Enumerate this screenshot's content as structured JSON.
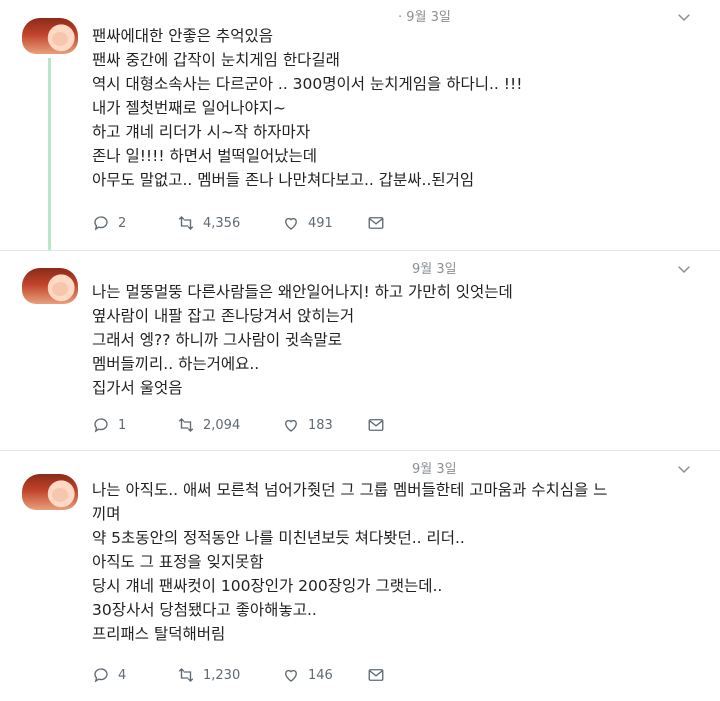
{
  "tweets": [
    {
      "date": "· 9월 3일",
      "lines": [
        "팬싸에대한 안좋은 추억있음",
        "팬싸 중간에 갑작이 눈치게임 한다길래",
        "역시 대형소속사는 다르군아 .. 300명이서 눈치게임을 하다니.. !!!",
        "내가 젤첫번째로 일어나야지~",
        "하고 걔네 리더가 시~작 하자마자",
        "존나 일!!!! 하면서 벌떡일어났는데",
        "아무도 말없고.. 멤버들 존나 나만쳐다보고.. 갑분싸..된거임"
      ],
      "replies": "2",
      "retweets": "4,356",
      "likes": "491"
    },
    {
      "date": "9월 3일",
      "lines": [
        "나는 멀뚱멀뚱 다른사람들은 왜안일어나지! 하고 가만히 잇엇는데",
        "옆사람이 내팔 잡고 존나당겨서 앉히는거",
        "그래서 엥?? 하니까 그사람이 귓속말로",
        "멤버들끼리.. 하는거에요..",
        "집가서 울엇음"
      ],
      "replies": "1",
      "retweets": "2,094",
      "likes": "183"
    },
    {
      "date": "9월 3일",
      "lines": [
        "나는 아직도.. 애써 모른척 넘어가줫던 그 그룹 멤버들한테 고마움과 수치심을 느",
        "끼며",
        "약 5초동안의 정적동안 나를 미친년보듯 쳐다봣던.. 리더..",
        "아직도 그 표정을 잊지못함",
        "당시 걔네 팬싸컷이 100장인가 200장잉가 그랫는데..",
        "30장사서 당첨됐다고 좋아해놓고..",
        "프리패스 탈덕해버림"
      ],
      "replies": "4",
      "retweets": "1,230",
      "likes": "146"
    }
  ],
  "icons": {
    "reply": "reply-icon",
    "retweet": "retweet-icon",
    "like": "heart-icon",
    "dm": "message-icon",
    "more": "chevron-down-icon"
  },
  "colors": {
    "thread_line": "#b9e6c8",
    "text": "#222222",
    "meta": "#8a8f94"
  }
}
